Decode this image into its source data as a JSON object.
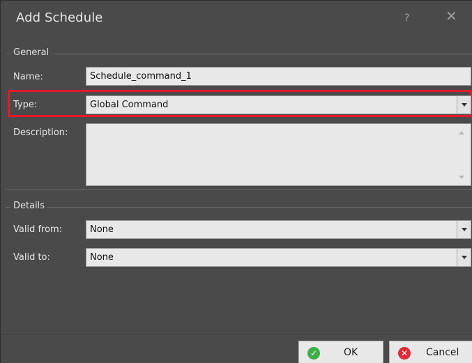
{
  "window": {
    "title": "Add Schedule",
    "help_glyph": "?",
    "close_glyph": "✕"
  },
  "general": {
    "label": "General",
    "name_label": "Name:",
    "name_value": "Schedule_command_1",
    "type_label": "Type:",
    "type_value": "Global Command",
    "description_label": "Description:",
    "description_value": ""
  },
  "details": {
    "label": "Details",
    "valid_from_label": "Valid from:",
    "valid_from_value": "None",
    "valid_to_label": "Valid to:",
    "valid_to_value": "None"
  },
  "buttons": {
    "ok_label": "OK",
    "cancel_label": "Cancel"
  },
  "colors": {
    "highlight": "#e3192b",
    "ok_icon": "#3fae49",
    "cancel_icon": "#e02a3a"
  },
  "icons": [
    "help-icon",
    "close-icon",
    "chevron-down-icon",
    "scroll-up-icon",
    "scroll-down-icon",
    "check-icon",
    "cancel-icon"
  ]
}
